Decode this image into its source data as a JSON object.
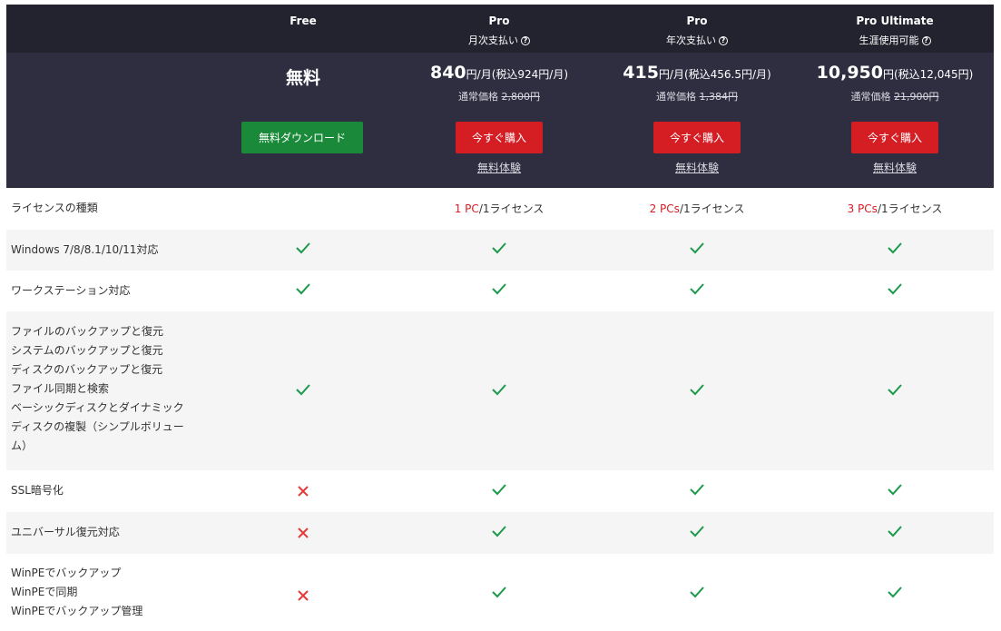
{
  "plans": [
    {
      "name": "Free",
      "sub": ""
    },
    {
      "name": "Pro",
      "sub": "月次支払い"
    },
    {
      "name": "Pro",
      "sub": "年次支払い"
    },
    {
      "name": "Pro Ultimate",
      "sub": "生涯使用可能"
    }
  ],
  "prices": {
    "free": "無料",
    "pro_monthly": {
      "amount": "840",
      "unit": "円/月(税込924円/月)",
      "normal_label": "通常価格",
      "normal_value": "2,800円"
    },
    "pro_yearly": {
      "amount": "415",
      "unit": "円/月(税込456.5円/月)",
      "normal_label": "通常価格",
      "normal_value": "1,384円"
    },
    "ultimate": {
      "amount": "10,950",
      "unit": "円(税込12,045円)",
      "normal_label": "通常価格",
      "normal_value": "21,900円"
    }
  },
  "buttons": {
    "free_download": "無料ダウンロード",
    "buy_now": "今すぐ購入",
    "free_trial": "無料体験"
  },
  "question_icon": "?",
  "features": {
    "license": {
      "label": "ライセンスの種類",
      "pro_m_red": "1 PC",
      "pro_y_red": "2 PCs",
      "ult_red": "3 PCs",
      "suffix": "/1ライセンス"
    },
    "windows": "Windows 7/8/8.1/10/11対応",
    "workstation": "ワークステーション対応",
    "backup_group": [
      "ファイルのバックアップと復元",
      "システムのバックアップと復元",
      "ディスクのバックアップと復元",
      "ファイル同期と検索",
      "ベーシックディスクとダイナミック",
      "ディスクの複製（シンプルボリュー",
      "ム）"
    ],
    "ssl": "SSL暗号化",
    "universal": "ユニバーサル復元対応",
    "winpe_group": [
      "WinPEでバックアップ",
      "WinPEで同期",
      "WinPEでバックアップ管理"
    ]
  },
  "colors": {
    "check": "#1a9a4a",
    "cross": "#e53a3a",
    "buy": "#d51d24",
    "download": "#1a8a3a"
  }
}
